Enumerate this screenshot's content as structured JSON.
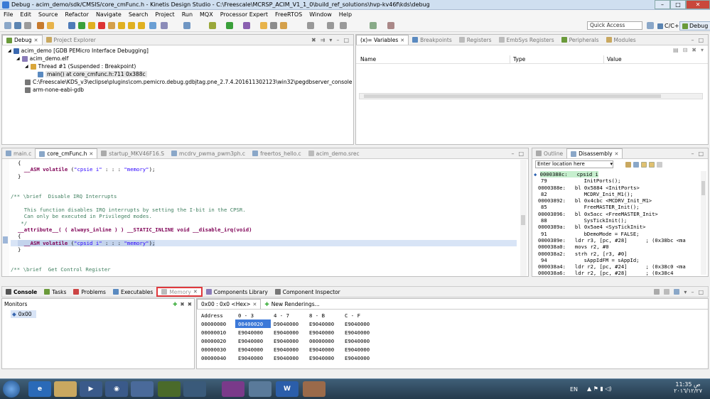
{
  "window": {
    "title": "Debug - acim_demo/sdk/CMSIS/core_cmFunc.h - Kinetis Design Studio - C:\\Freescale\\MCRSP_ACIM_V1_1_0\\build_ref_solutions\\hvp-kv46f\\kds\\debug",
    "min": "–",
    "max": "□",
    "close": "✕"
  },
  "menu": [
    "File",
    "Edit",
    "Source",
    "Refactor",
    "Navigate",
    "Search",
    "Project",
    "Run",
    "MQX",
    "Processor Expert",
    "FreeRTOS",
    "Window",
    "Help"
  ],
  "toolbar": {
    "quick_access": "Quick Access",
    "perspectives": [
      "C/C++",
      "Debug"
    ]
  },
  "debug_view": {
    "tabs": [
      "Debug",
      "Project Explorer"
    ],
    "tree": [
      "acim_demo [GDB PEMicro Interface Debugging]",
      "acim_demo.elf",
      "Thread #1 (Suspended : Breakpoint)",
      "main() at core_cmfunc.h:711 0x388c",
      "C:\\Freescale\\KDS_v3\\eclipse\\plugins\\com.pemicro.debug.gdbjtag.pne_2.7.4.201611302123\\win32\\pegdbserver_console",
      "arm-none-eabi-gdb"
    ]
  },
  "variables_view": {
    "tabs": [
      "(x)= Variables",
      "Breakpoints",
      "Registers",
      "EmbSys Registers",
      "Peripherals",
      "Modules"
    ],
    "columns": [
      "Name",
      "Type",
      "Value"
    ]
  },
  "editor": {
    "tabs": [
      "main.c",
      "core_cmFunc.h",
      "startup_MKV46F16.S",
      "mcdrv_pwma_pwm3ph.c",
      "freertos_hello.c",
      "acim_demo.srec"
    ],
    "lines": [
      "{",
      "  __ASM volatile (\"cpsie i\" : : : \"memory\");",
      "}",
      "",
      "",
      "/** \\brief  Disable IRQ Interrupts",
      "",
      "  This function disables IRQ interrupts by setting the I-bit in the CPSR.",
      "  Can only be executed in Privileged modes.",
      " */",
      "__attribute__( ( always_inline ) ) __STATIC_INLINE void __disable_irq(void)",
      "{",
      "  __ASM volatile (\"cpsid i\" : : : \"memory\");",
      "}",
      "",
      "",
      "/** \\brief  Get Control Register"
    ]
  },
  "disassembly_view": {
    "tabs": [
      "Outline",
      "Disassembly"
    ],
    "location_placeholder": "Enter location here",
    "lines": [
      "0000388c:   cpsid i",
      "79            InitPorts();",
      "0000388e:   bl 0x5884 <InitPorts>",
      "82            MCDRV_Init_M1();",
      "00003892:   bl 0x4cbc <MCDRV_Init_M1>",
      "85            FreeMASTER_Init();",
      "00003896:   bl 0x5acc <FreeMASTER_Init>",
      "88            SysTickInit();",
      "0000389a:   bl 0x5ae4 <SysTickInit>",
      "91            bDemoMode = FALSE;",
      "0000389e:   ldr r3, [pc, #28]      ; (0x38bc <ma",
      "000038a0:   movs r2, #0",
      "000038a2:   strh r2, [r3, #0]",
      "94            sAppIdFM = sAppId;",
      "000038a4:   ldr r2, [pc, #24]      ; (0x38c0 <ma",
      "000038a6:   ldr r2, [pc, #28]      ; (0x38c4"
    ]
  },
  "bottom_tabs": [
    "Console",
    "Tasks",
    "Problems",
    "Executables",
    "Memory",
    "Components Library",
    "Component Inspector"
  ],
  "memory_view": {
    "monitors_label": "Monitors",
    "monitor": "0x00",
    "rendering_tabs": [
      "0x00 : 0x0 <Hex>",
      "New Renderings..."
    ],
    "columns": [
      "Address",
      "0 - 3",
      "4 - 7",
      "8 - B",
      "C - F"
    ],
    "rows": [
      [
        "00000000",
        "00400020",
        "D9040000",
        "E9040000",
        "E9040000"
      ],
      [
        "00000010",
        "E9040000",
        "E9040000",
        "E9040000",
        "E9040000"
      ],
      [
        "00000020",
        "E9040000",
        "E9040000",
        "00000000",
        "E9040000"
      ],
      [
        "00000030",
        "E9040000",
        "E9040000",
        "E9040000",
        "E9040000"
      ],
      [
        "00000040",
        "E9040000",
        "E9040000",
        "E9040000",
        "E9040000"
      ]
    ]
  },
  "taskbar": {
    "lang": "EN",
    "time": "11:35 ص",
    "date": "٢٠١٦/١٢/٢٧"
  },
  "colors": {
    "highlight": "#d8e4f6",
    "selection_box": "#e0393d",
    "keyword": "#7f0055",
    "comment": "#3f7f5f",
    "string": "#2a00ff"
  }
}
